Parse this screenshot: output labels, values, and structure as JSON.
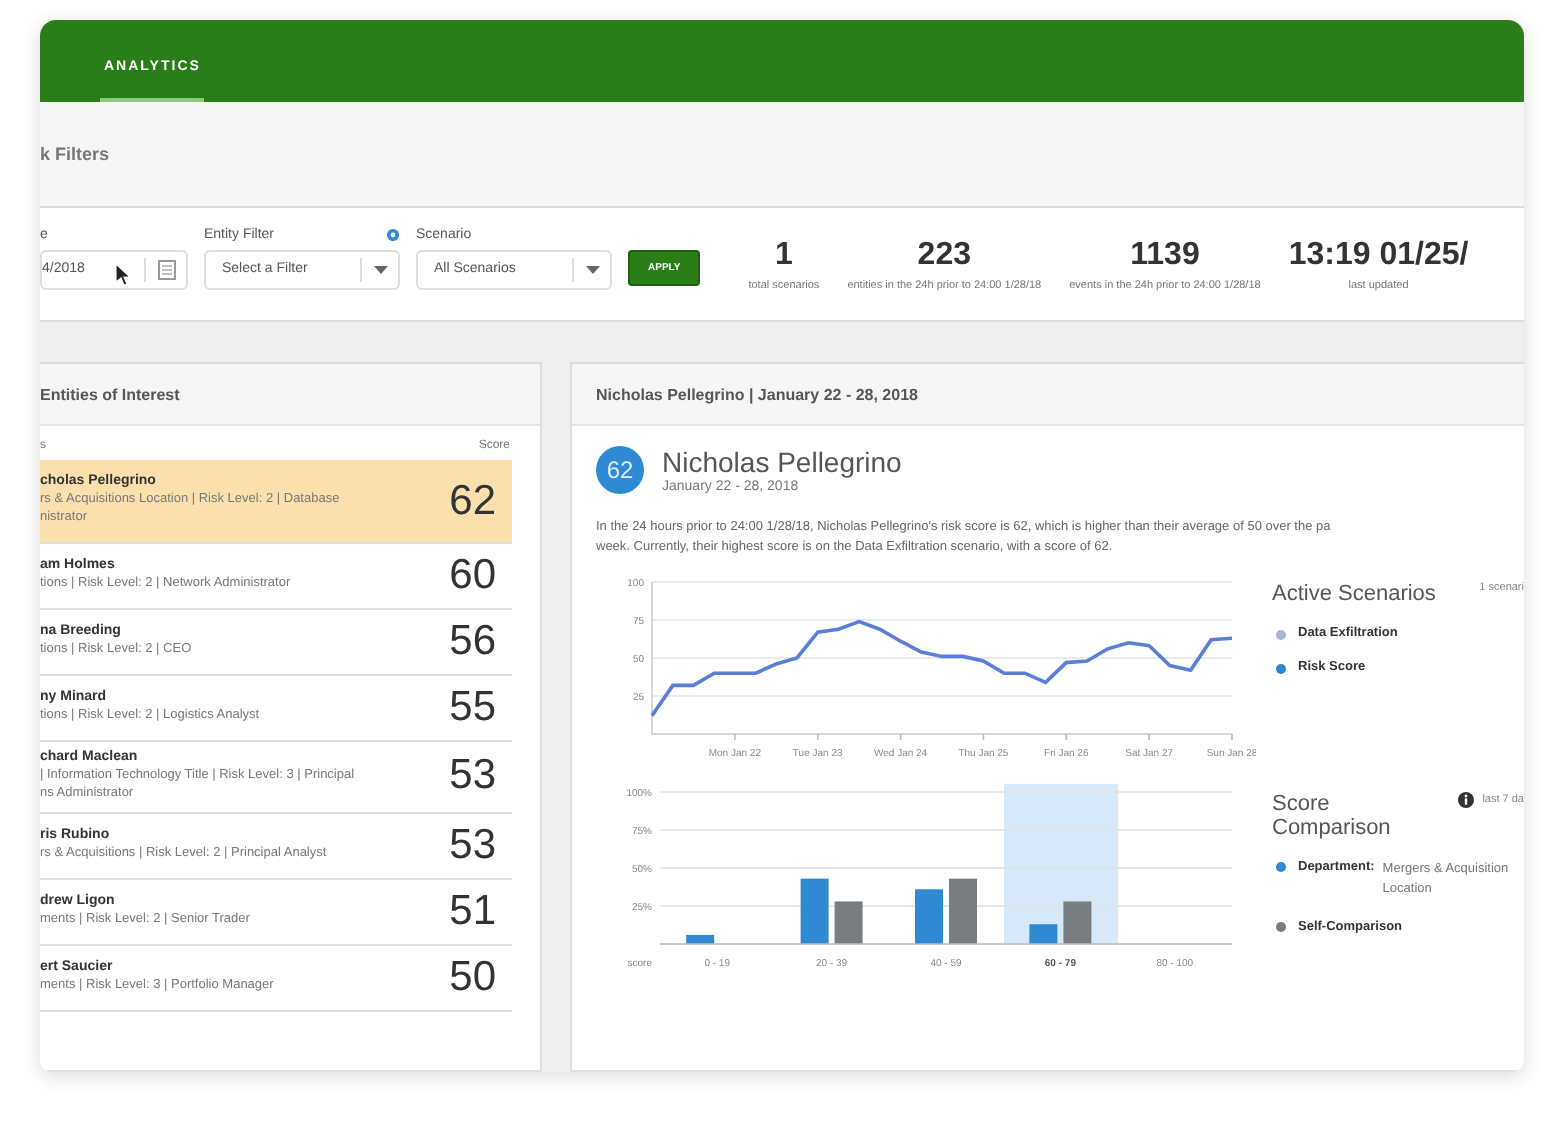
{
  "nav": {
    "tabs": [
      {
        "label": "ANALYTICS",
        "selected": true
      }
    ]
  },
  "filters": {
    "title": "k Filters",
    "date": {
      "label": "e",
      "value": "4/2018"
    },
    "entity_filter": {
      "label": "Entity Filter",
      "placeholder": "Select a Filter"
    },
    "scenario": {
      "label": "Scenario",
      "value": "All Scenarios"
    },
    "apply_button": "APPLY"
  },
  "stats": [
    {
      "value": "1",
      "caption": "total scenarios"
    },
    {
      "value": "223",
      "caption": "entities in the 24h prior to 24:00 1/28/18"
    },
    {
      "value": "1139",
      "caption": "events in the 24h prior to 24:00 1/28/18"
    },
    {
      "value": "13:19 01/25/",
      "caption": "last updated"
    }
  ],
  "entities": {
    "title": "Entities of Interest",
    "column_1": "s",
    "score_header": "Score",
    "rows": [
      {
        "name": "cholas Pellegrino",
        "detail_lines": [
          "rs & Acquisitions Location | Risk Level: 2 | Database",
          "nistrator"
        ],
        "score": "62",
        "selected": true
      },
      {
        "name": "am Holmes",
        "detail_lines": [
          "tions | Risk Level: 2 | Network Administrator"
        ],
        "score": "60",
        "selected": false
      },
      {
        "name": "na Breeding",
        "detail_lines": [
          "tions | Risk Level: 2 | CEO"
        ],
        "score": "56",
        "selected": false
      },
      {
        "name": "ny Minard",
        "detail_lines": [
          "tions | Risk Level: 2 | Logistics Analyst"
        ],
        "score": "55",
        "selected": false
      },
      {
        "name": "chard Maclean",
        "detail_lines": [
          "| Information Technology Title | Risk Level: 3 | Principal",
          "ns Administrator"
        ],
        "score": "53",
        "selected": false
      },
      {
        "name": "ris Rubino",
        "detail_lines": [
          "rs & Acquisitions | Risk Level: 2 | Principal Analyst"
        ],
        "score": "53",
        "selected": false
      },
      {
        "name": "drew Ligon",
        "detail_lines": [
          "ments | Risk Level: 2 | Senior Trader"
        ],
        "score": "51",
        "selected": false
      },
      {
        "name": "ert Saucier",
        "detail_lines": [
          "ments | Risk Level: 3 | Portfolio Manager"
        ],
        "score": "50",
        "selected": false
      }
    ]
  },
  "detail": {
    "header": "Nicholas Pellegrino | January 22 - 28, 2018",
    "badge": "62",
    "name": "Nicholas Pellegrino",
    "date": "January 22 - 28, 2018",
    "summary_lines": [
      "In the 24 hours prior to 24:00 1/28/18, Nicholas Pellegrino's risk score is 62, which is higher than their average of 50 over the pa",
      "week. Currently, their highest score is on the Data Exfiltration scenario, with a score of 62."
    ],
    "risk_chart": {
      "chart_data": {
        "type": "line",
        "grid": true,
        "ylim": [
          0,
          100
        ],
        "yticks": [
          25,
          50,
          75,
          100
        ],
        "categories": [
          null,
          null,
          null,
          null,
          "Mon Jan 22",
          null,
          null,
          null,
          "Tue Jan 23",
          null,
          null,
          null,
          "Wed Jan 24",
          null,
          null,
          null,
          "Thu Jan 25",
          null,
          null,
          null,
          "Fri Jan 26",
          null,
          null,
          null,
          "Sat Jan 27",
          null,
          null,
          null,
          "Sun Jan 28"
        ],
        "series": [
          {
            "color": "#5b7fd6",
            "values": [
              12,
              32,
              32,
              40,
              40,
              40,
              46,
              50,
              67,
              69,
              74,
              69,
              61,
              54,
              51,
              51,
              48,
              40,
              40,
              34,
              47,
              48,
              56,
              60,
              58,
              45,
              42,
              62,
              63
            ]
          }
        ]
      }
    },
    "active_scenarios": {
      "title": "Active Scenarios",
      "count": "1 scenari",
      "legend": [
        {
          "label": "Data Exfiltration",
          "color": "#a9b6d6"
        },
        {
          "label": "Risk Score",
          "color": "#2a86d1"
        }
      ]
    },
    "comparison_chart": {
      "chart_data": {
        "type": "bar",
        "grid": true,
        "xlabel": "score",
        "categories": [
          "0 - 19",
          "20 - 39",
          "40 - 59",
          "60 - 79",
          "80 - 100"
        ],
        "ylim": [
          0,
          100
        ],
        "yticks": [
          {
            "value": 25,
            "label": "25%"
          },
          {
            "value": 50,
            "label": "50%"
          },
          {
            "value": 75,
            "label": "75%"
          },
          {
            "value": 100,
            "label": "100%"
          }
        ],
        "series": [
          {
            "color": "#2f8ad3",
            "values": [
              6,
              43,
              36,
              13,
              null
            ]
          },
          {
            "color": "#7a7d80",
            "values": [
              null,
              28,
              43,
              28,
              null
            ]
          }
        ]
      },
      "score_ranges": [
        {
          "selected": false
        },
        {
          "selected": false
        },
        {
          "selected": false
        },
        {
          "selected": true
        },
        {
          "selected": false
        }
      ]
    },
    "score_comparison": {
      "title": "Score Comparison",
      "period": "last 7 da",
      "legend": [
        {
          "label": "Department:",
          "value_lines": [
            "Mergers & Acquisition",
            "Location"
          ],
          "color": "#2f8ad3"
        },
        {
          "label": "Self-Comparison",
          "color": "#7a7d80"
        }
      ]
    }
  }
}
